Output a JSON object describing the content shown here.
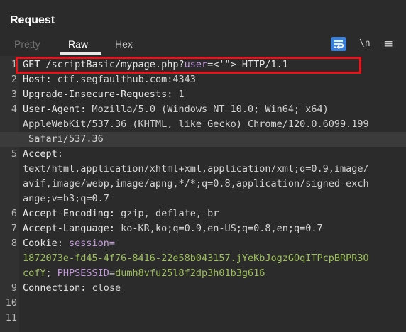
{
  "panel": {
    "title": "Request"
  },
  "tabs": [
    {
      "label": "Pretty"
    },
    {
      "label": "Raw"
    },
    {
      "label": "Hex"
    }
  ],
  "tools": {
    "newline_label": "\\n",
    "menu_label": "≡"
  },
  "lines": [
    {
      "num": "1",
      "parts": [
        [
          "GET /scriptBasic/mypage.php?",
          "path"
        ],
        [
          "user",
          "param"
        ],
        [
          "=<'\">",
          "eq"
        ],
        [
          " HTTP/1.1",
          "path"
        ]
      ]
    },
    {
      "num": "2",
      "parts": [
        [
          "Host: ",
          "hdr"
        ],
        [
          "ctf.segfaulthub.com:4343",
          "val"
        ]
      ]
    },
    {
      "num": "3",
      "parts": [
        [
          "Upgrade-Insecure-Requests: ",
          "hdr"
        ],
        [
          "1",
          "val"
        ]
      ]
    },
    {
      "num": "4",
      "parts": [
        [
          "User-Agent: ",
          "hdr"
        ],
        [
          "Mozilla/5.0 (Windows NT 10.0; Win64; x64)",
          "val"
        ]
      ]
    },
    {
      "num": "",
      "parts": [
        [
          "AppleWebKit/537.36 (KHTML, like Gecko) Chrome/120.0.6099.199",
          "val"
        ]
      ]
    },
    {
      "num": "",
      "parts": [
        [
          " Safari/537.36",
          "val"
        ]
      ],
      "highlight": true
    },
    {
      "num": "5",
      "parts": [
        [
          "Accept:",
          "hdr"
        ]
      ]
    },
    {
      "num": "",
      "parts": [
        [
          "text/html,application/xhtml+xml,application/xml;q=0.9,image/",
          "val"
        ]
      ]
    },
    {
      "num": "",
      "parts": [
        [
          "avif,image/webp,image/apng,*/*;q=0.8,application/signed-exch",
          "val"
        ]
      ]
    },
    {
      "num": "",
      "parts": [
        [
          "ange;v=b3;q=0.7",
          "val"
        ]
      ]
    },
    {
      "num": "6",
      "parts": [
        [
          "Accept-Encoding: ",
          "hdr"
        ],
        [
          "gzip, deflate, br",
          "val"
        ]
      ]
    },
    {
      "num": "7",
      "parts": [
        [
          "Accept-Language: ",
          "hdr"
        ],
        [
          "ko-KR,ko;q=0.9,en-US;q=0.8,en;q=0.7",
          "val"
        ]
      ]
    },
    {
      "num": "8",
      "parts": [
        [
          "Cookie: ",
          "hdr"
        ],
        [
          "session=",
          "param"
        ]
      ]
    },
    {
      "num": "",
      "parts": [
        [
          "1872073e-fd45-4f76-8416-22e58b043157.jYeKbJogzGOqITPcpBRPR3O",
          "cookie-val"
        ]
      ]
    },
    {
      "num": "",
      "parts": [
        [
          "cofY",
          "cookie-val"
        ],
        [
          "; ",
          "val"
        ],
        [
          "PHPSESSID",
          "param"
        ],
        [
          "=",
          "eq"
        ],
        [
          "dumh8vfu25l8f2dp3h01b3g616",
          "cookie-val"
        ]
      ]
    },
    {
      "num": "9",
      "parts": [
        [
          "Connection: ",
          "hdr"
        ],
        [
          "close",
          "val"
        ]
      ]
    },
    {
      "num": "10",
      "parts": []
    },
    {
      "num": "11",
      "parts": []
    }
  ]
}
